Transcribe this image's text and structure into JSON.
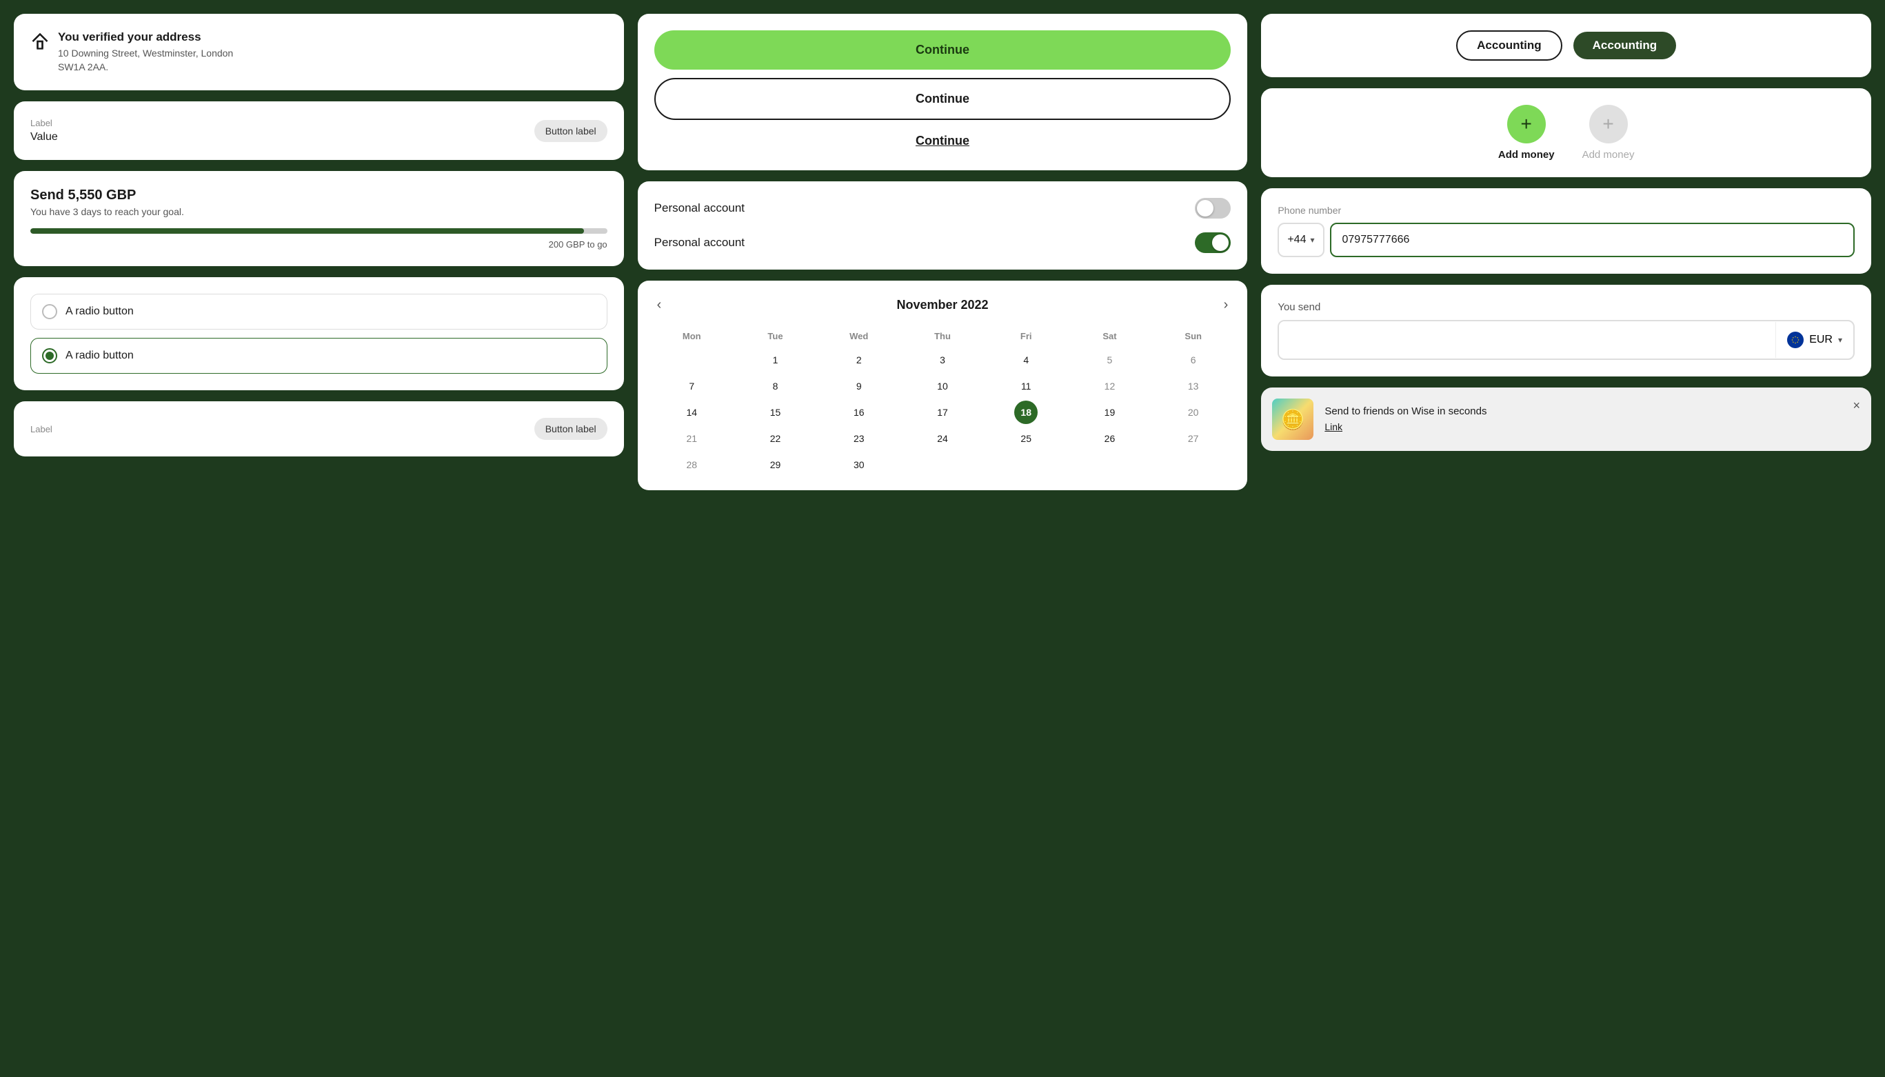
{
  "background_color": "#1e3a1e",
  "left_column": {
    "address_card": {
      "title": "You verified your address",
      "line1": "10 Downing Street, Westminster, London",
      "line2": "SW1A 2AA."
    },
    "label_value_card": {
      "label": "Label",
      "value": "Value",
      "button_label": "Button label"
    },
    "send_card": {
      "title": "Send 5,550 GBP",
      "subtitle": "You have 3 days to reach your goal.",
      "progress_percent": 96,
      "progress_label": "200 GBP to go"
    },
    "radio_card": {
      "option1": "A radio button",
      "option2": "A radio button",
      "option1_selected": false,
      "option2_selected": true
    },
    "bottom_label_card": {
      "label": "Label",
      "button_label": "Button label"
    }
  },
  "middle_column": {
    "buttons_card": {
      "btn_filled": "Continue",
      "btn_outline": "Continue",
      "btn_text": "Continue"
    },
    "toggle_card": {
      "toggle1_label": "Personal account",
      "toggle1_on": false,
      "toggle2_label": "Personal account",
      "toggle2_on": true
    },
    "calendar_card": {
      "month_year": "November 2022",
      "days_header": [
        "Mon",
        "Tue",
        "Wed",
        "Thu",
        "Fri",
        "Sat",
        "Sun"
      ],
      "weeks": [
        [
          null,
          "1",
          "2",
          "3",
          "4",
          "5",
          "6"
        ],
        [
          "7",
          "8",
          "9",
          "10",
          "11",
          "12",
          "13",
          "14"
        ],
        [
          "15",
          "16",
          "17",
          "18",
          "19",
          "20",
          "21"
        ],
        [
          "22",
          "23",
          "24",
          "25",
          "26",
          "27",
          "28"
        ],
        [
          "29",
          "30",
          null,
          null,
          null,
          null,
          null
        ]
      ],
      "selected_day": "18",
      "prev_label": "‹",
      "next_label": "›"
    }
  },
  "right_column": {
    "accounting_card": {
      "btn1_label": "Accounting",
      "btn2_label": "Accounting"
    },
    "add_money_card": {
      "item1_label": "Add money",
      "item1_active": true,
      "item2_label": "Add money",
      "item2_active": false
    },
    "phone_card": {
      "label": "Phone number",
      "country_code": "+44",
      "phone_value": "07975777666"
    },
    "you_send_card": {
      "label": "You send",
      "currency": "EUR",
      "input_value": ""
    },
    "notification_card": {
      "title": "Send to friends on Wise in seconds",
      "link_label": "Link",
      "close_label": "×",
      "emoji": "🪙"
    }
  },
  "icons": {
    "house": "⌂",
    "plus": "+",
    "chevron_down": "▾",
    "chevron_left": "‹",
    "chevron_right": "›",
    "star_coins": "🪙"
  }
}
